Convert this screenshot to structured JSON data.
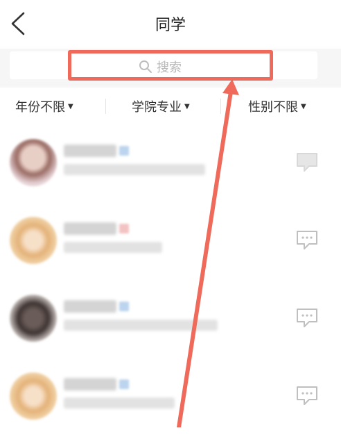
{
  "header": {
    "title": "同学"
  },
  "search": {
    "placeholder": "搜索"
  },
  "filters": [
    {
      "label": "年份不限"
    },
    {
      "label": "学院专业"
    },
    {
      "label": "性别不限"
    }
  ],
  "colors": {
    "accent": "#ef6a5a",
    "text": "#222222",
    "placeholder": "#b8b8b8"
  },
  "icons": {
    "back": "chevron-left-icon",
    "search": "search-icon",
    "chat": "chat-bubble-icon",
    "caret": "triangle-down-icon"
  }
}
